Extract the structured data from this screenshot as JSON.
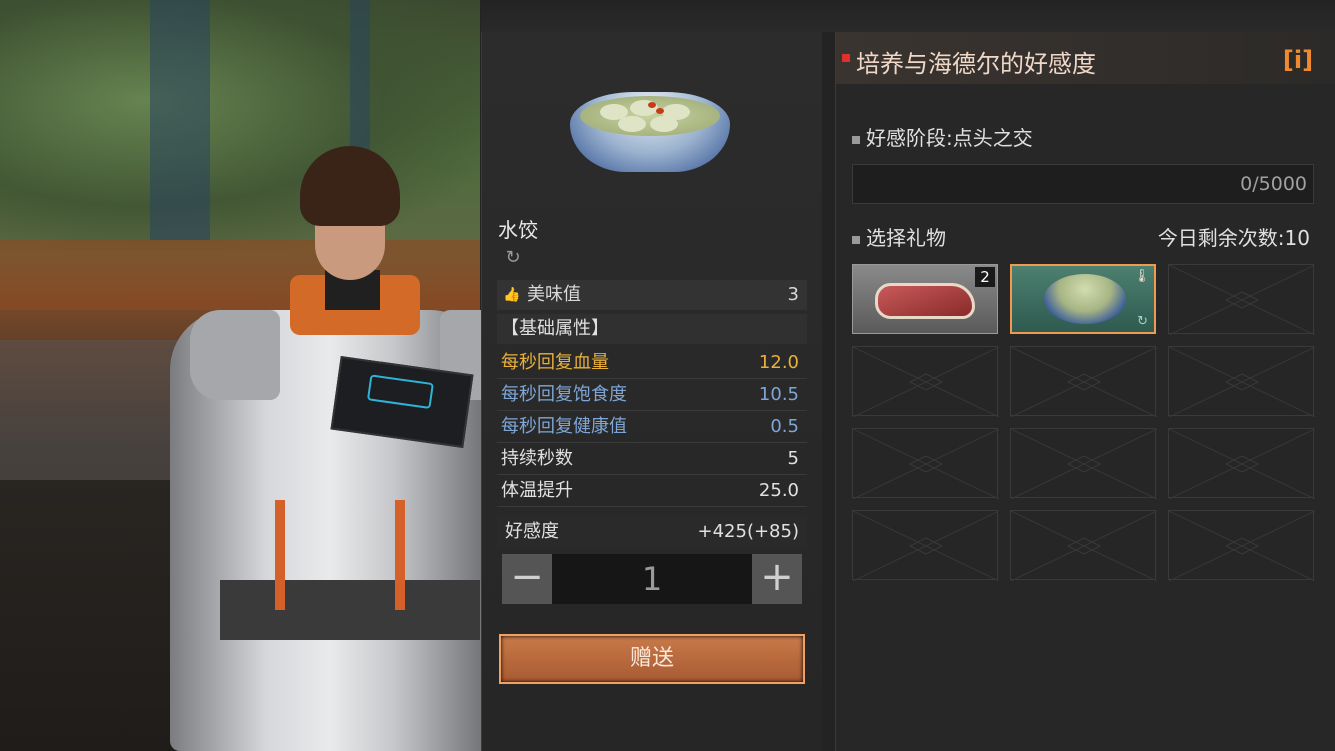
{
  "item": {
    "name": "水饺",
    "type_icon": "recycle-swirl-icon",
    "taste_label": "美味值",
    "taste_value": "3",
    "section_title": "【基础属性】",
    "stats": [
      {
        "label": "每秒回复血量",
        "value": "12.0",
        "color": "#e9b03a"
      },
      {
        "label": "每秒回复饱食度",
        "value": "10.5",
        "color": "#7ea6d6"
      },
      {
        "label": "每秒回复健康值",
        "value": "0.5",
        "color": "#7ea6d6"
      },
      {
        "label": "持续秒数",
        "value": "5",
        "color": "#e0e0e0"
      },
      {
        "label": "体温提升",
        "value": "25.0",
        "color": "#e0e0e0"
      }
    ],
    "affinity_label": "好感度",
    "affinity_value": "+425(+85)",
    "quantity": "1",
    "give_label": "赠送"
  },
  "affinity": {
    "title": "培养与海德尔的好感度",
    "info_icon": "i",
    "stage_label": "好感阶段:点头之交",
    "progress_text": "0/5000",
    "progress_fraction": 0,
    "select_gift_label": "选择礼物",
    "remaining_label": "今日剩余次数:10"
  },
  "gifts": [
    {
      "kind": "meat",
      "count": "2",
      "selected": false
    },
    {
      "kind": "dumpling-bowl",
      "count": "",
      "selected": true
    },
    {
      "kind": "empty"
    },
    {
      "kind": "empty"
    },
    {
      "kind": "empty"
    },
    {
      "kind": "empty"
    },
    {
      "kind": "empty"
    },
    {
      "kind": "empty"
    },
    {
      "kind": "empty"
    },
    {
      "kind": "empty"
    },
    {
      "kind": "empty"
    },
    {
      "kind": "empty"
    }
  ],
  "colors": {
    "accent": "#f09a50",
    "gold": "#e9b03a",
    "blue": "#7ea6d6",
    "title_mark": "#e0302a"
  }
}
